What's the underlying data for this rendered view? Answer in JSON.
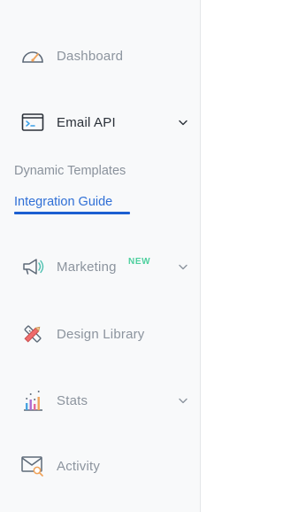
{
  "nav": {
    "dashboard": {
      "label": "Dashboard",
      "icon": "gauge-icon"
    },
    "email_api": {
      "label": "Email API",
      "icon": "terminal-window-icon"
    },
    "marketing": {
      "label": "Marketing",
      "icon": "megaphone-icon",
      "badge": "NEW"
    },
    "design_library": {
      "label": "Design Library",
      "icon": "pencil-ruler-icon"
    },
    "stats": {
      "label": "Stats",
      "icon": "bar-chart-icon"
    },
    "activity": {
      "label": "Activity",
      "icon": "envelope-search-icon"
    }
  },
  "email_api_sub": {
    "dynamic_templates": "Dynamic Templates",
    "integration_guide": "Integration Guide"
  },
  "colors": {
    "active_link": "#2f6fd6",
    "new_badge": "#4ed09e",
    "muted_text": "#8c949e"
  }
}
